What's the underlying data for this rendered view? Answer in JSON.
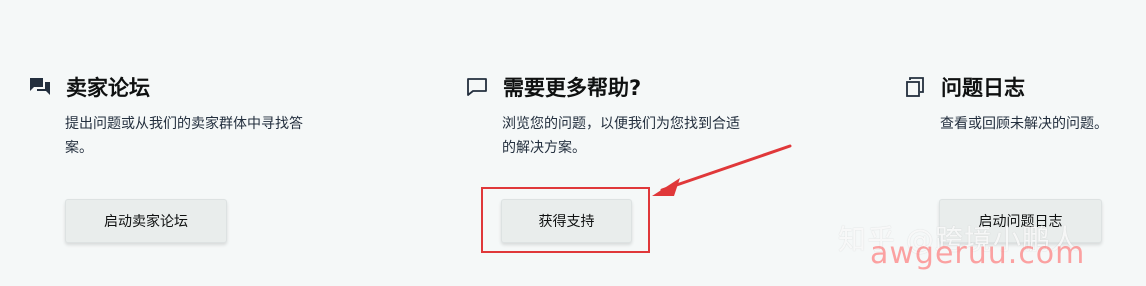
{
  "columns": {
    "forum": {
      "icon": "chat-bubbles-icon",
      "title": "卖家论坛",
      "description": "提出问题或从我们的卖家群体中寻找答案。",
      "button_label": "启动卖家论坛"
    },
    "help": {
      "icon": "speech-bubble-icon",
      "title": "需要更多帮助?",
      "description": "浏览您的问题，以便我们为您找到合适的解决方案。",
      "button_label": "获得支持"
    },
    "log": {
      "icon": "copy-pages-icon",
      "title": "问题日志",
      "description": "查看或回顾未解决的问题。",
      "button_label": "启动问题日志"
    }
  },
  "annotation": {
    "highlight_color": "#e0383a"
  },
  "watermark": {
    "text": "知乎 @跨境小鹏人",
    "url": "awgeruu.com"
  }
}
